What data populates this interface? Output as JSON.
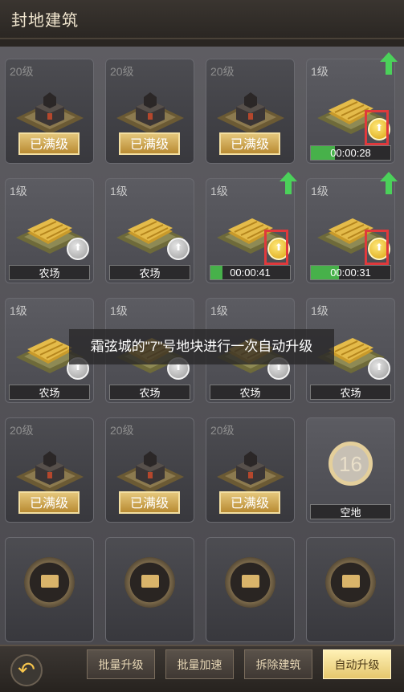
{
  "header": {
    "title": "封地建筑"
  },
  "toast": {
    "text": "霜弦城的\"7\"号地块进行一次自动升级"
  },
  "colors": {
    "accent_green": "#47b14a",
    "highlight_red": "#e0393c",
    "gold": "#d9a20f"
  },
  "rows": [
    [
      {
        "level": "20级",
        "type": "manor",
        "status": "已满级"
      },
      {
        "level": "20级",
        "type": "manor",
        "status": "已满级"
      },
      {
        "level": "20级",
        "type": "manor",
        "status": "已满级"
      },
      {
        "level": "1级",
        "type": "farm",
        "timer": "00:00:28",
        "progress": 0.3,
        "upgrade_coin": "gold",
        "highlight": true,
        "arrow": true
      }
    ],
    [
      {
        "level": "1级",
        "type": "farm",
        "name": "农场",
        "upgrade_coin": "gray"
      },
      {
        "level": "1级",
        "type": "farm",
        "name": "农场",
        "upgrade_coin": "gray"
      },
      {
        "level": "1级",
        "type": "farm",
        "timer": "00:00:41",
        "progress": 0.15,
        "upgrade_coin": "gold",
        "highlight": true,
        "arrow": true
      },
      {
        "level": "1级",
        "type": "farm",
        "timer": "00:00:31",
        "progress": 0.35,
        "upgrade_coin": "gold",
        "highlight": true,
        "arrow": true
      }
    ],
    [
      {
        "level": "1级",
        "type": "farm",
        "name": "农场",
        "upgrade_coin": "gray"
      },
      {
        "level": "1级",
        "type": "farm",
        "name": "农场",
        "upgrade_coin": "gray"
      },
      {
        "level": "1级",
        "type": "farm",
        "name": "农场",
        "upgrade_coin": "gray"
      },
      {
        "level": "1级",
        "type": "farm",
        "name": "农场",
        "upgrade_coin": "gray"
      }
    ],
    [
      {
        "level": "20级",
        "type": "manor",
        "status": "已满级"
      },
      {
        "level": "20级",
        "type": "manor",
        "status": "已满级"
      },
      {
        "level": "20级",
        "type": "manor",
        "status": "已满级"
      },
      {
        "type": "empty",
        "slot_number": "16",
        "name": "空地"
      }
    ],
    [
      {
        "type": "locked"
      },
      {
        "type": "locked"
      },
      {
        "type": "locked"
      },
      {
        "type": "locked"
      }
    ]
  ],
  "bottom_bar": {
    "back_icon": "back-arrow-icon",
    "buttons": [
      "批量升级",
      "批量加速",
      "拆除建筑",
      "自动升级"
    ],
    "active_index": 3
  }
}
